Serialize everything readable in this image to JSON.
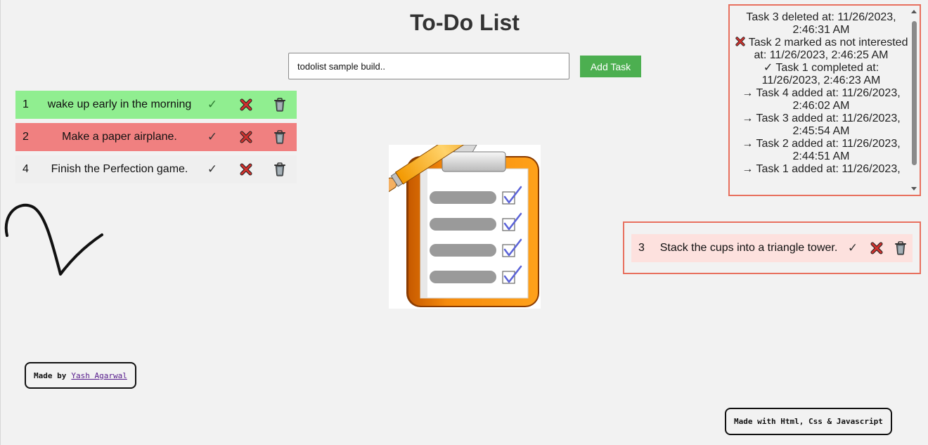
{
  "app": {
    "title": "To-Do List"
  },
  "input": {
    "value": "todolist sample build..",
    "add_button_label": "Add Task"
  },
  "tasks": [
    {
      "number": "1",
      "text": "wake up early in the morning",
      "status": "completed",
      "check_symbol": "✓"
    },
    {
      "number": "2",
      "text": "Make a paper airplane.",
      "status": "not-interested",
      "check_symbol": "✓"
    },
    {
      "number": "4",
      "text": "Finish the Perfection game.",
      "status": "pending",
      "check_symbol": "✓"
    }
  ],
  "log": {
    "entries": [
      "Task 3 deleted at: 11/26/2023, 2:46:31 AM",
      "Task 2 marked as not interested at: 11/26/2023, 2:46:25 AM",
      "✓ Task 1 completed at: 11/26/2023, 2:46:23 AM",
      "→ Task 4 added at: 11/26/2023, 2:46:02 AM",
      "→ Task 3 added at: 11/26/2023, 2:45:54 AM",
      "→ Task 2 added at: 11/26/2023, 2:44:51 AM",
      "→ Task 1 added at: 11/26/2023,"
    ]
  },
  "dragged_task": {
    "number": "3",
    "text": "Stack the cups into a triangle tower.",
    "check_symbol": "✓"
  },
  "footer": {
    "made_by_prefix": "Made by",
    "author": "Yash Agarwal",
    "tech": "Made with Html, Css & Javascript"
  },
  "colors": {
    "completed": "#90ee90",
    "not_interested": "#f08080",
    "accent_button": "#4caf50",
    "dropzone_border": "#e8705e",
    "dragged_task_bg": "#fde1de"
  },
  "icons": {
    "complete": "check-icon",
    "not_interested": "x-icon",
    "delete": "trash-icon",
    "illustration": "clipboard-pencil-icon"
  }
}
